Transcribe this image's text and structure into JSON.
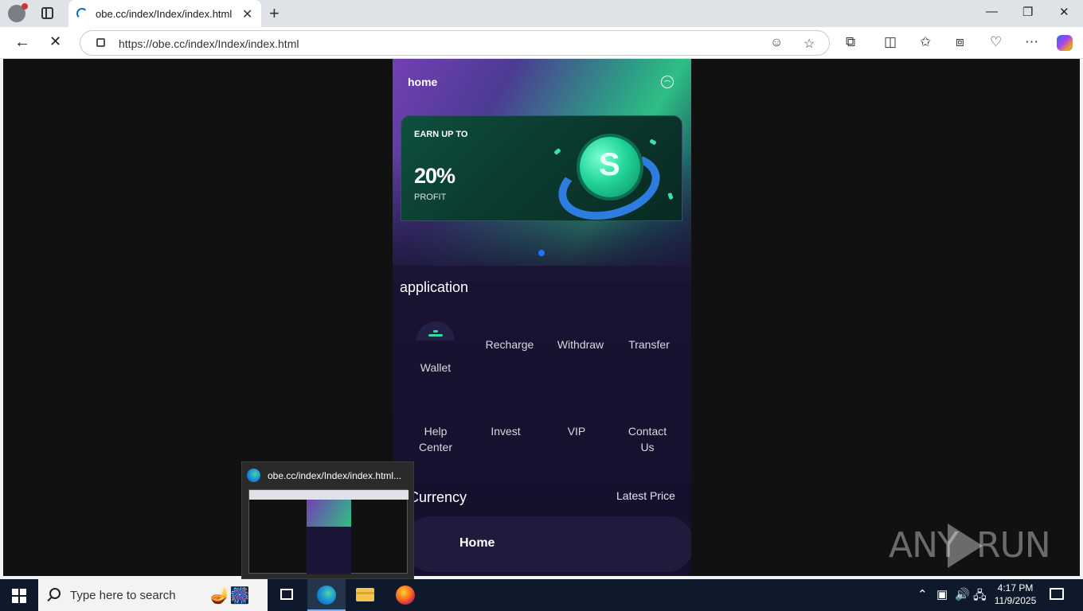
{
  "browser": {
    "tab_title": "obe.cc/index/Index/index.html",
    "url": "https://obe.cc/index/Index/index.html",
    "tab_close": "✕",
    "new_tab": "+",
    "minimize": "—",
    "restore": "❐",
    "close": "✕",
    "back": "←",
    "stop": "✕"
  },
  "app": {
    "header_title": "home",
    "banner": {
      "earn_label": "EARN UP TO",
      "percent": "20%",
      "profit_label": "PROFIT",
      "coin_symbol": "S"
    },
    "application_title": "application",
    "grid": [
      {
        "label": "Wallet"
      },
      {
        "label": "Recharge"
      },
      {
        "label": "Withdraw"
      },
      {
        "label": "Transfer"
      },
      {
        "label": "Help Center"
      },
      {
        "label": "Invest"
      },
      {
        "label": "VIP"
      },
      {
        "label": "Contact Us"
      }
    ],
    "currency_title": "Currency",
    "latest_price": "Latest Price",
    "tabbar_home": "Home"
  },
  "preview": {
    "title": "obe.cc/index/Index/index.html..."
  },
  "taskbar": {
    "search_placeholder": "Type here to search",
    "time": "4:17 PM",
    "date": "11/9/2025"
  },
  "watermark": {
    "left": "ANY",
    "right": "RUN"
  },
  "colors": {
    "accent_green": "#35d9a4",
    "pager_dot": "#1f75ff",
    "app_bg": "#1b1537"
  }
}
